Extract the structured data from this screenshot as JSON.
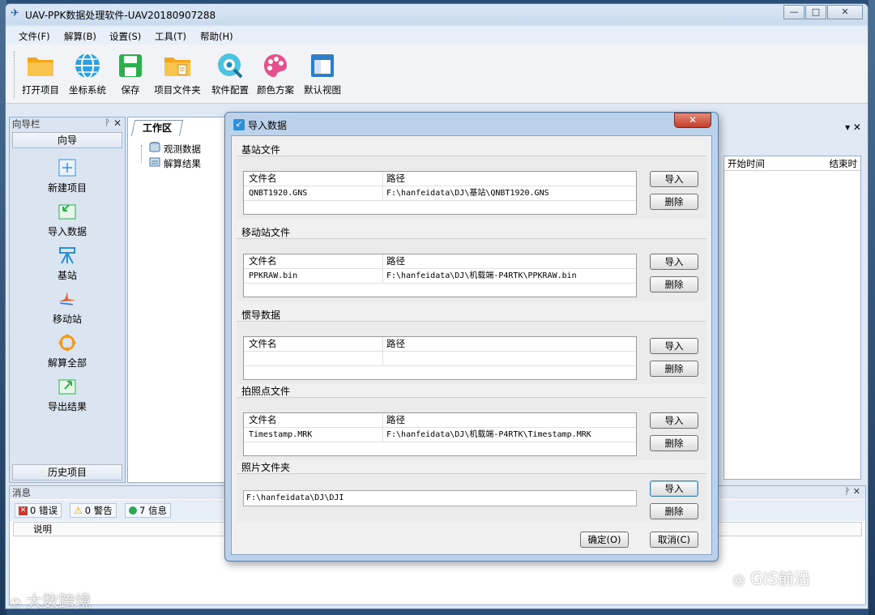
{
  "window": {
    "title": "UAV-PPK数据处理软件-UAV20180907288",
    "controls": [
      "—",
      "□",
      "✕"
    ]
  },
  "menu": [
    "文件(F)",
    "解算(B)",
    "设置(S)",
    "工具(T)",
    "帮助(H)"
  ],
  "toolbar": [
    {
      "label": "打开项目",
      "icon": "open-folder-icon"
    },
    {
      "label": "坐标系统",
      "icon": "globe-icon"
    },
    {
      "label": "保存",
      "icon": "save-icon"
    },
    {
      "label": "项目文件夹",
      "icon": "project-folder-icon"
    },
    {
      "label": "软件配置",
      "icon": "config-icon"
    },
    {
      "label": "颜色方案",
      "icon": "palette-icon"
    },
    {
      "label": "默认视图",
      "icon": "default-view-icon"
    }
  ],
  "nav": {
    "header": "向导栏",
    "pin": "ᚹ",
    "close": "✕",
    "title": "向导",
    "items": [
      "新建项目",
      "导入数据",
      "基站",
      "移动站",
      "解算全部",
      "导出结果"
    ],
    "footer": "历史项目"
  },
  "workspace": {
    "tab": "工作区",
    "tree": [
      "观测数据",
      "解算结果"
    ]
  },
  "right_panel": {
    "controls": "▾ ✕",
    "columns": [
      "开始时间",
      "结束时"
    ]
  },
  "messages": {
    "header": "消息",
    "controls": "ᚹ ✕",
    "tabs": [
      "0 错误",
      "0 警告",
      "7 信息"
    ],
    "column": "说明"
  },
  "dialog": {
    "title": "导入数据",
    "close": "✕",
    "col_name": "文件名",
    "col_path": "路径",
    "import": "导入",
    "delete": "删除",
    "groups": [
      {
        "title": "基站文件",
        "rows": [
          {
            "name": "QNBT1920.GNS",
            "path": "F:\\hanfeidata\\DJ\\基站\\QNBT1920.GNS"
          }
        ]
      },
      {
        "title": "移动站文件",
        "rows": [
          {
            "name": "PPKRAW.bin",
            "path": "F:\\hanfeidata\\DJ\\机载端-P4RTK\\PPKRAW.bin"
          }
        ]
      },
      {
        "title": "惯导数据",
        "rows": []
      },
      {
        "title": "拍照点文件",
        "rows": [
          {
            "name": "Timestamp.MRK",
            "path": "F:\\hanfeidata\\DJ\\机载端-P4RTK\\Timestamp.MRK"
          }
        ]
      }
    ],
    "photo_folder": {
      "title": "照片文件夹",
      "path": "F:\\hanfeidata\\DJ\\DJI"
    },
    "ok": "确定(O)",
    "cancel": "取消(C)"
  },
  "watermarks": [
    "大数跨境",
    "GIS前沿"
  ]
}
